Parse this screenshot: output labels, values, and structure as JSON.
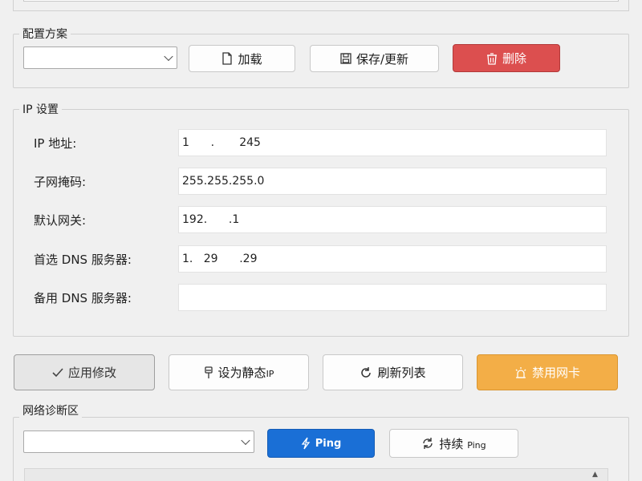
{
  "profile": {
    "group_title": "配置方案",
    "combo_value": "",
    "load_label": "加载",
    "save_label": "保存/更新",
    "delete_label": "删除"
  },
  "ip_settings": {
    "group_title": "IP 设置",
    "fields": [
      {
        "label": "IP 地址:",
        "value": "1      .       245"
      },
      {
        "label": "子网掩码:",
        "value": "255.255.255.0"
      },
      {
        "label": "默认网关:",
        "value": "192.      .1"
      },
      {
        "label": "首选 DNS 服务器:",
        "value": "1.   29      .29"
      },
      {
        "label": "备用 DNS 服务器:",
        "value": ""
      }
    ]
  },
  "actions": {
    "apply_label": "应用修改",
    "static_label": "设为静态",
    "static_suffix": "IP",
    "refresh_label": "刷新列表",
    "disable_label": "禁用网卡"
  },
  "diagnostics": {
    "group_title": "网络诊断区",
    "combo_value": "",
    "ping_label": "Ping",
    "continuous_label": "持续",
    "continuous_suffix": "Ping"
  },
  "colors": {
    "delete": "#dc4f4f",
    "ping": "#1a6fd6",
    "disable": "#f3ae47"
  }
}
